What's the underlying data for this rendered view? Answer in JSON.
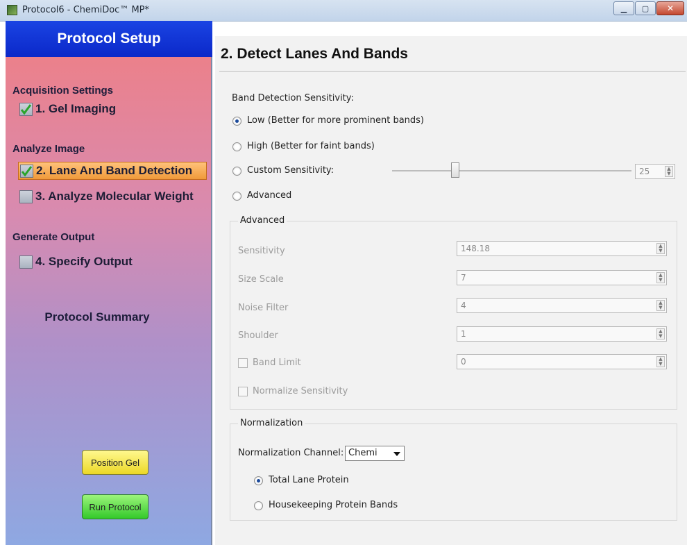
{
  "window": {
    "title": "Protocol6 - ChemiDoc™ MP*"
  },
  "sidebar": {
    "header": "Protocol Setup",
    "sections": [
      {
        "label": "Acquisition Settings"
      },
      {
        "label": "Analyze Image"
      },
      {
        "label": "Generate Output"
      }
    ],
    "items": [
      {
        "label": "1. Gel Imaging",
        "checked": true
      },
      {
        "label": "2. Lane And Band Detection",
        "checked": true,
        "active": true
      },
      {
        "label": "3. Analyze Molecular Weight",
        "checked": false
      },
      {
        "label": "4. Specify Output",
        "checked": false
      }
    ],
    "summary_label": "Protocol Summary",
    "position_gel_label": "Position Gel",
    "run_protocol_label": "Run Protocol"
  },
  "main": {
    "title": "2. Detect Lanes And Bands",
    "sensitivity_label": "Band Detection Sensitivity:",
    "options": [
      {
        "label": "Low (Better for more prominent bands)",
        "selected": true
      },
      {
        "label": "High (Better for faint bands)",
        "selected": false
      },
      {
        "label": "Custom Sensitivity:",
        "selected": false
      },
      {
        "label": "Advanced",
        "selected": false
      }
    ],
    "custom_value": "25",
    "custom_slider_fraction": 0.25,
    "advanced": {
      "group_label": "Advanced",
      "fields": [
        {
          "label": "Sensitivity",
          "value": "148.18"
        },
        {
          "label": "Size Scale",
          "value": "7"
        },
        {
          "label": "Noise Filter",
          "value": "4"
        },
        {
          "label": "Shoulder",
          "value": "1"
        }
      ],
      "band_limit_label": "Band Limit",
      "band_limit_value": "0",
      "normalize_label": "Normalize Sensitivity"
    },
    "normalization": {
      "group_label": "Normalization",
      "channel_label": "Normalization Channel:",
      "channel_value": "Chemi",
      "options": [
        {
          "label": "Total Lane Protein",
          "selected": true
        },
        {
          "label": "Housekeeping Protein Bands",
          "selected": false
        }
      ]
    }
  }
}
